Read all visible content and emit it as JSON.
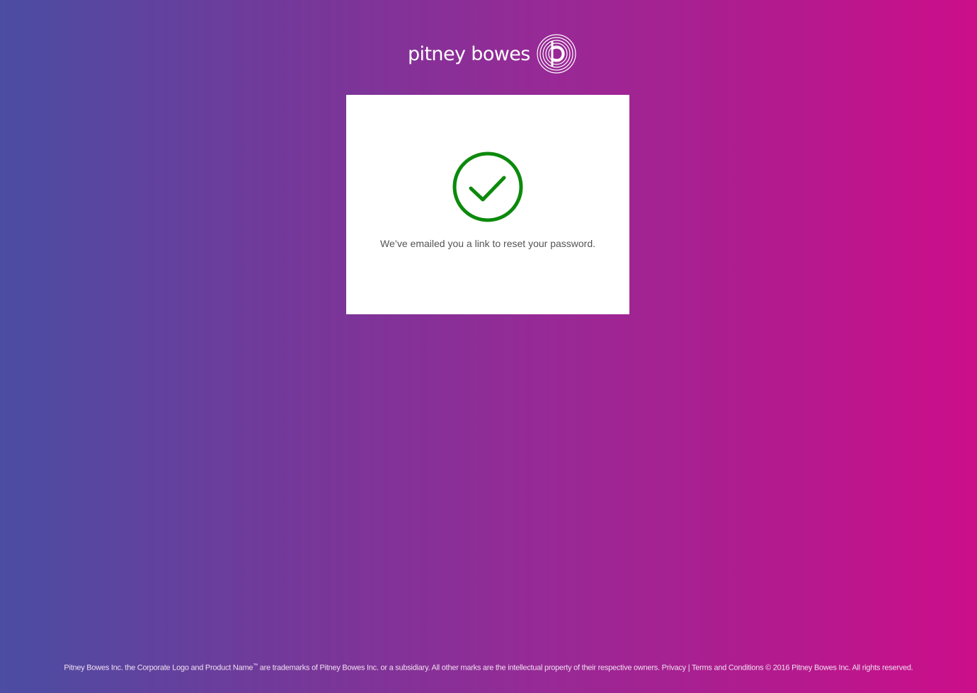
{
  "brand": {
    "name": "pitney bowes",
    "logo_icon": "pitney-bowes-concentric-p-logo"
  },
  "card": {
    "status_icon": "check-circle-icon",
    "status_color": "#0c8a0c",
    "message": "We’ve emailed you a link to reset your password."
  },
  "footer": {
    "text_before_tm": "Pitney Bowes Inc. the Corporate Logo and Product Name",
    "tm": "™",
    "text_after_tm": " are trademarks of Pitney Bowes Inc. or a subsidiary. All other marks are the intellectual property of their respective owners. ",
    "privacy_link": "Privacy",
    "separator": " | ",
    "terms_link": "Terms and Conditions",
    "copyright": " © 2016 Pitney Bowes Inc. All rights reserved."
  }
}
